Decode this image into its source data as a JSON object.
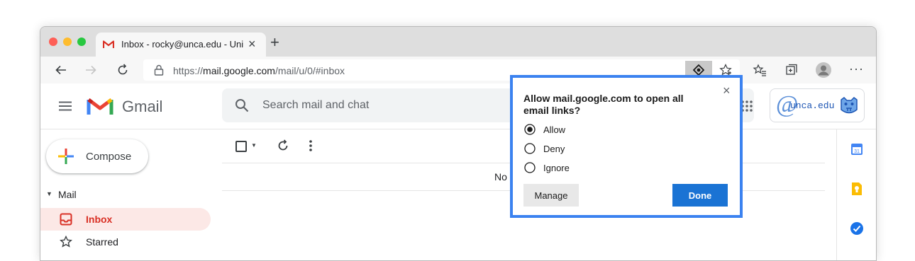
{
  "tab": {
    "title": "Inbox - rocky@unca.edu - University of North Carolina at Asheville Mail",
    "close": "×",
    "new_tab": "+"
  },
  "address": {
    "protocol": "https://",
    "host": "mail.google.com",
    "path": "/mail/u/0/#inbox"
  },
  "gmail": {
    "product_name": "Gmail",
    "search_placeholder": "Search mail and chat",
    "brand_text": "unca.edu",
    "compose_label": "Compose",
    "mail_section_label": "Mail",
    "nav": [
      {
        "label": "Inbox"
      },
      {
        "label": "Starred"
      }
    ],
    "empty_message": "No"
  },
  "popup": {
    "title": "Allow mail.google.com to open all email links?",
    "options": [
      {
        "label": "Allow",
        "selected": true
      },
      {
        "label": "Deny",
        "selected": false
      },
      {
        "label": "Ignore",
        "selected": false
      }
    ],
    "manage_label": "Manage",
    "done_label": "Done"
  },
  "colors": {
    "accent": "#3b82f0",
    "done_button": "#1a73d4",
    "inbox_active": "#d93025",
    "inbox_bg": "#fce8e6"
  }
}
